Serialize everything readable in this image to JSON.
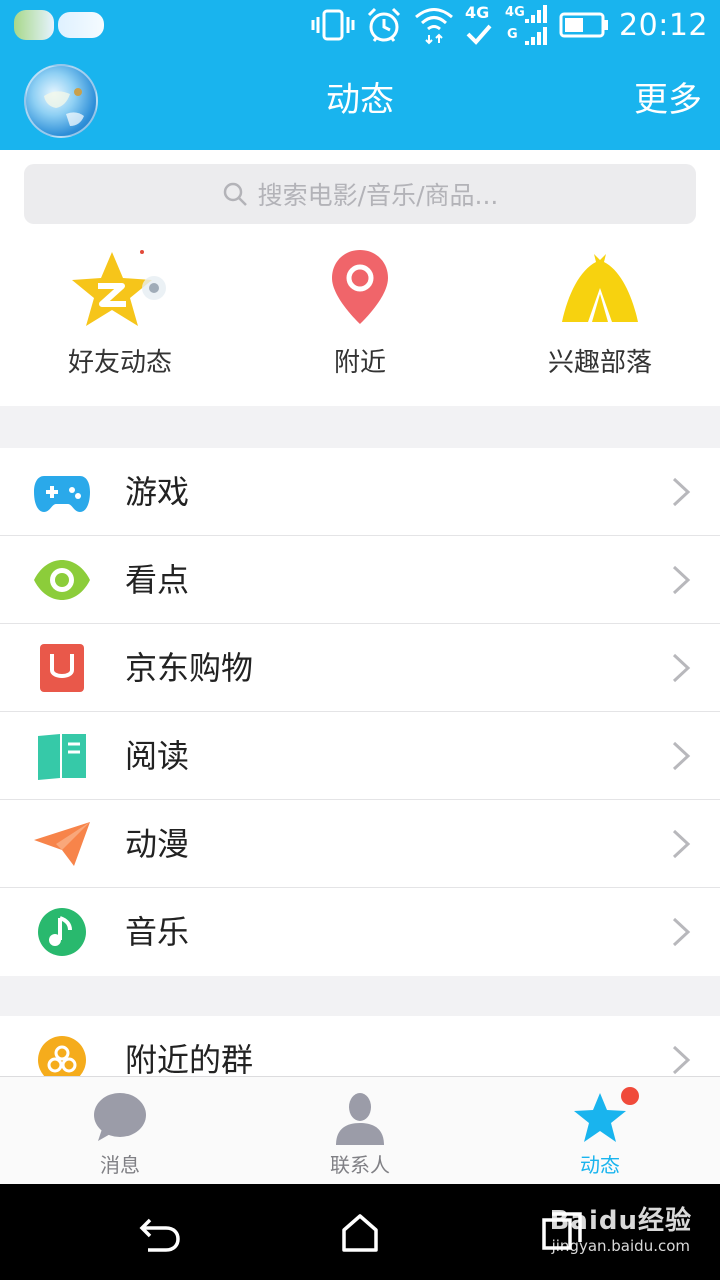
{
  "status_bar": {
    "time": "20:12",
    "network_1": "4G",
    "network_2": "4G"
  },
  "header": {
    "title": "动态",
    "more": "更多"
  },
  "search": {
    "placeholder": "搜索电影/音乐/商品..."
  },
  "quick_entries": [
    {
      "label": "好友动态",
      "icon": "qzone-star-icon",
      "color": "#f6c51a"
    },
    {
      "label": "附近",
      "icon": "location-pin-icon",
      "color": "#f0656a"
    },
    {
      "label": "兴趣部落",
      "icon": "tent-icon",
      "color": "#f7d20f"
    }
  ],
  "list_section_1": [
    {
      "label": "游戏",
      "icon": "gamepad-icon",
      "color": "#2aa9ea"
    },
    {
      "label": "看点",
      "icon": "eye-icon",
      "color": "#8ccd3a"
    },
    {
      "label": "京东购物",
      "icon": "jd-bag-icon",
      "color": "#e9584a"
    },
    {
      "label": "阅读",
      "icon": "book-icon",
      "color": "#36c9a8"
    },
    {
      "label": "动漫",
      "icon": "paper-plane-icon",
      "color": "#f7844a"
    },
    {
      "label": "音乐",
      "icon": "music-note-icon",
      "color": "#29b96e"
    }
  ],
  "list_section_2": [
    {
      "label": "附近的群",
      "icon": "group-icon",
      "color": "#f5ac1c"
    }
  ],
  "tab_bar": {
    "tabs": [
      {
        "label": "消息",
        "icon": "message-bubble-icon",
        "active": false
      },
      {
        "label": "联系人",
        "icon": "contacts-icon",
        "active": false
      },
      {
        "label": "动态",
        "icon": "star-icon",
        "active": true
      }
    ]
  },
  "watermark": {
    "line1": "Baidu经验",
    "line2": "jingyan.baidu.com"
  },
  "colors": {
    "brand": "#19b4ee",
    "badge": "#f04a3a"
  }
}
